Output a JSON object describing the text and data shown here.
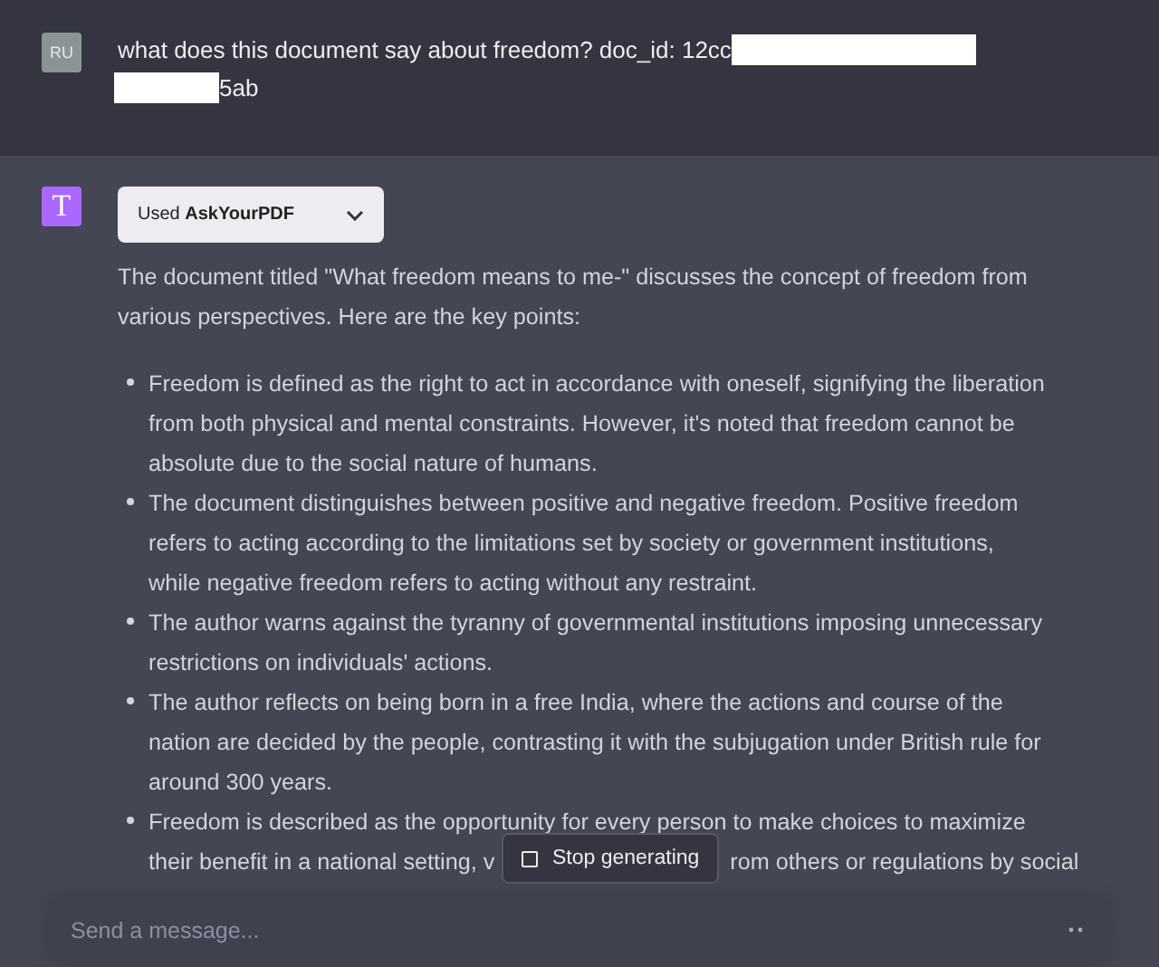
{
  "user_message": {
    "avatar": "RU",
    "lines": [
      [
        {
          "kind": "text",
          "text": "what does this document say about freedom? doc_id: 12cc"
        },
        {
          "kind": "redacted"
        }
      ],
      [
        {
          "kind": "redacted"
        },
        {
          "kind": "text",
          "text": "5ab"
        }
      ]
    ]
  },
  "assistant_message": {
    "avatar": "T",
    "plugin": {
      "prefix": "Used",
      "name": "AskYourPDF",
      "expanded": false
    },
    "intro": "The document titled \"What freedom means to me-\" discusses the concept of freedom from various perspectives. Here are the key points:",
    "points": [
      {
        "text": "Freedom is defined as the right to act in accordance with oneself, signifying the liberation from both physical and mental constraints. However, it's noted that freedom cannot be absolute due to the social nature of humans."
      },
      {
        "text": "The document distinguishes between positive and negative freedom. Positive freedom refers to acting according to the limitations set by society or government institutions, while negative freedom refers to acting without any restraint."
      },
      {
        "text": "The author warns against the tyranny of governmental institutions imposing unnecessary restrictions on individuals' actions."
      },
      {
        "text": "The author reflects on being born in a free India, where the actions and course of the nation are decided by the people, contrasting it with the subjugation under British rule for around 300 years."
      },
      {
        "lines": [
          [
            "Freedom is described as the opportunity for every person to make choices to maximize"
          ],
          [
            "their benefit in a national setting, v",
            "rom others or regulations by social"
          ]
        ]
      }
    ]
  },
  "stop_button": "Stop generating",
  "composer": {
    "placeholder": "Send a message..."
  }
}
